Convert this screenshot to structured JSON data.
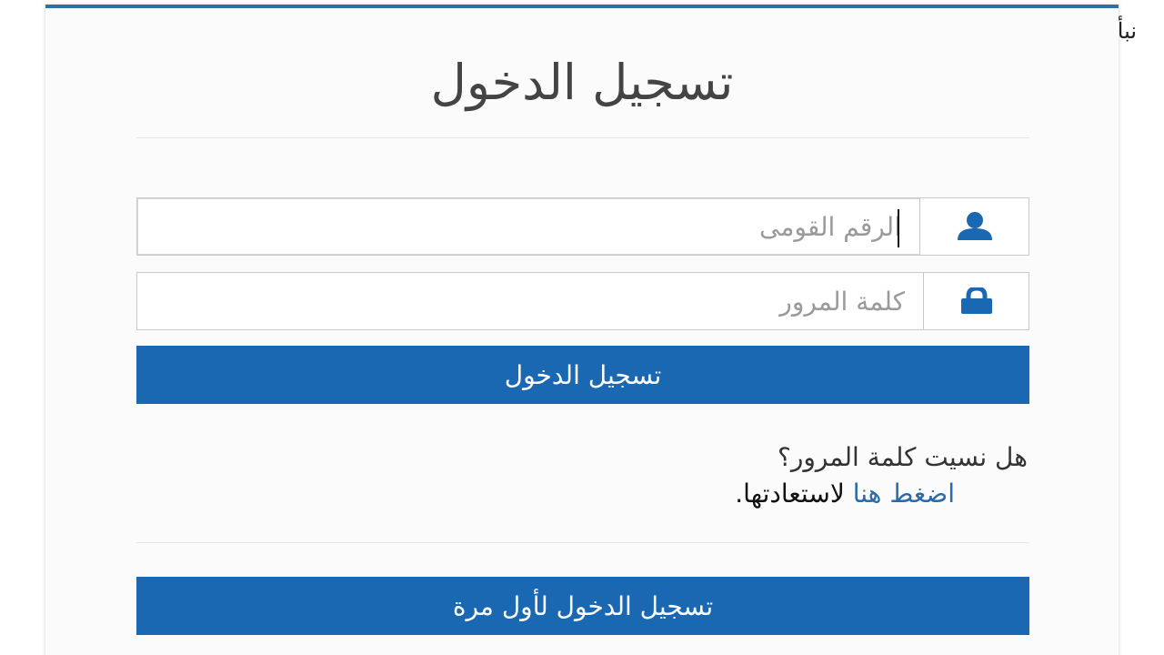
{
  "watermark": {
    "text": "نبأ العرب"
  },
  "login": {
    "title": "تسجيل الدخول",
    "national_id": {
      "placeholder": "الرقم القومى",
      "value": "",
      "icon": "user-icon"
    },
    "password": {
      "placeholder": "كلمة المرور",
      "value": "",
      "icon": "lock-icon"
    },
    "submit_label": "تسجيل الدخول",
    "forgot_question": "هل نسيت كلمة المرور؟",
    "recover_link": "اضغط هنا",
    "recover_suffix": " لاستعادتها.",
    "first_login_label": "تسجيل الدخول لأول مرة"
  },
  "colors": {
    "primary": "#1a68b2",
    "link": "#2a6aa6",
    "card_border_top": "#2f6fa8"
  }
}
